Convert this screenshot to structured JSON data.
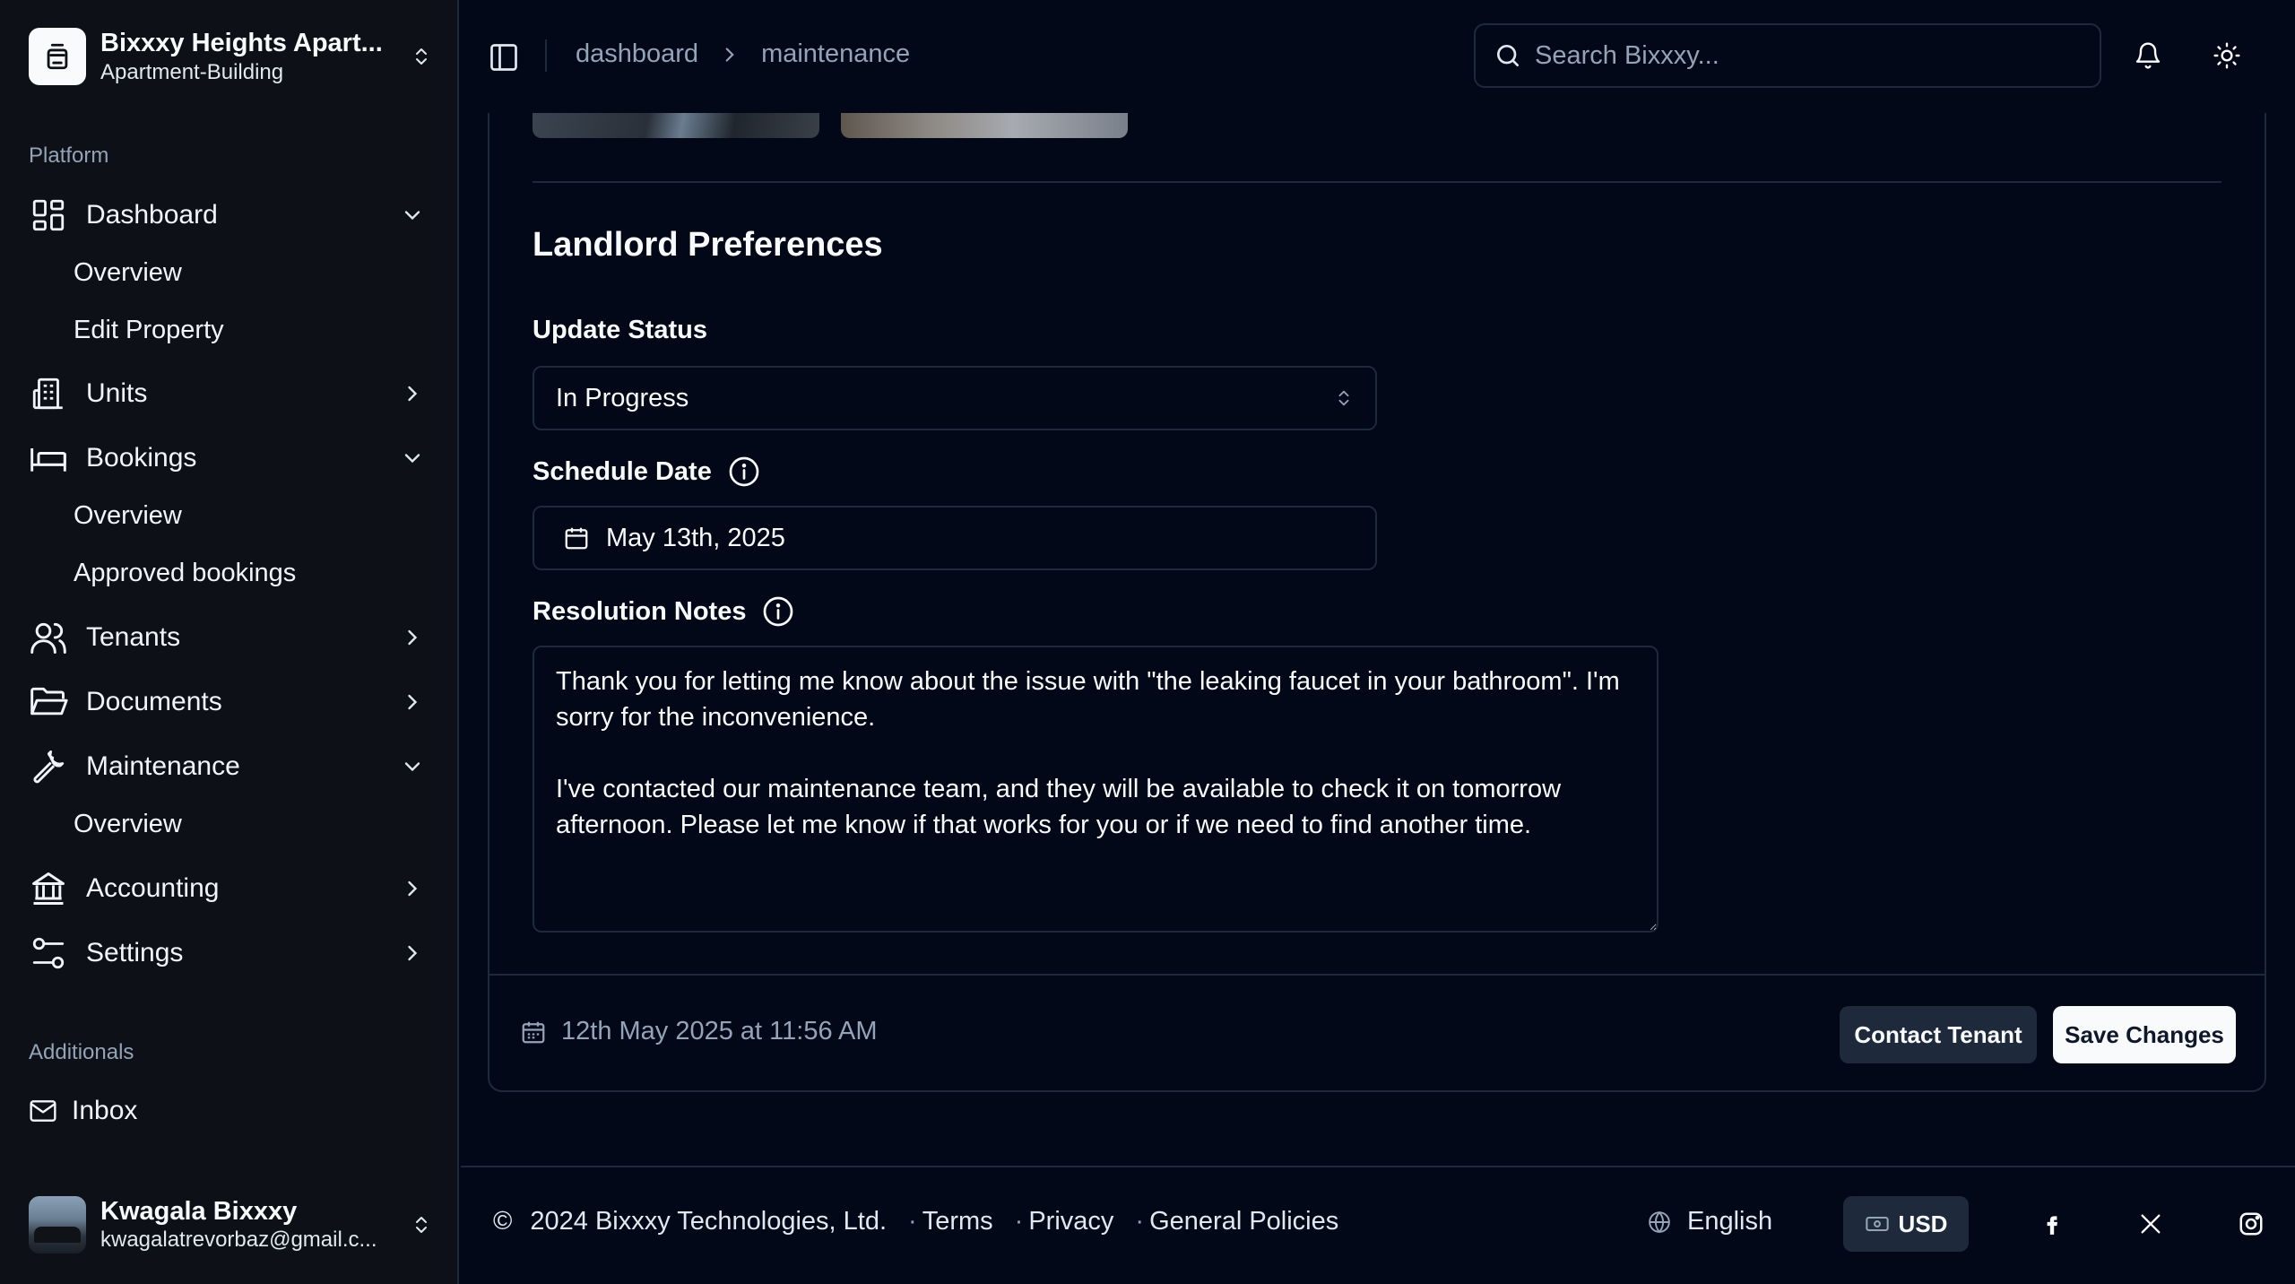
{
  "org": {
    "name": "Bixxxy Heights Apart...",
    "type": "Apartment-Building",
    "logo_icon": "building-icon"
  },
  "sidebar": {
    "platform_label": "Platform",
    "additionals_label": "Additionals",
    "items": [
      {
        "label": "Dashboard",
        "icon": "dashboard-grid-icon",
        "expanded": true,
        "subitems": [
          "Overview",
          "Edit Property"
        ]
      },
      {
        "label": "Units",
        "icon": "building-icon",
        "expanded": false
      },
      {
        "label": "Bookings",
        "icon": "bed-icon",
        "expanded": true,
        "subitems": [
          "Overview",
          "Approved bookings"
        ]
      },
      {
        "label": "Tenants",
        "icon": "users-icon",
        "expanded": false
      },
      {
        "label": "Documents",
        "icon": "folder-open-icon",
        "expanded": false
      },
      {
        "label": "Maintenance",
        "icon": "wrench-icon",
        "expanded": true,
        "subitems": [
          "Overview"
        ]
      },
      {
        "label": "Accounting",
        "icon": "bank-icon",
        "expanded": false
      },
      {
        "label": "Settings",
        "icon": "sliders-icon",
        "expanded": false
      }
    ],
    "additional_items": [
      {
        "label": "Inbox",
        "icon": "mail-icon"
      }
    ]
  },
  "user": {
    "name": "Kwagala Bixxxy",
    "email": "kwagalatrevorbaz@gmail.c..."
  },
  "header": {
    "breadcrumbs": [
      "dashboard",
      "maintenance"
    ],
    "search_placeholder": "Search Bixxxy..."
  },
  "form": {
    "section_title": "Landlord Preferences",
    "status_label": "Update Status",
    "status_value": "In Progress",
    "schedule_label": "Schedule Date",
    "schedule_value": "May 13th, 2025",
    "notes_label": "Resolution Notes",
    "notes_value": "Thank you for letting me know about the issue with \"the leaking faucet in your bathroom\". I'm sorry for the inconvenience.\n\nI've contacted our maintenance team, and they will be available to check it on tomorrow afternoon. Please let me know if that works for you or if we need to find another time.",
    "timestamp": "12th May 2025 at 11:56 AM",
    "contact_button": "Contact Tenant",
    "save_button": "Save Changes"
  },
  "footer": {
    "copyright_symbol": "©",
    "copyright": "2024 Bixxxy Technologies, Ltd.",
    "links": [
      "Terms",
      "Privacy",
      "General Policies"
    ],
    "language": "English",
    "currency": "USD"
  },
  "colors": {
    "background": "#020817",
    "sidebar": "#0d1117",
    "border": "#1e293b",
    "text": "#f8fafc",
    "muted": "#94a3b8"
  }
}
